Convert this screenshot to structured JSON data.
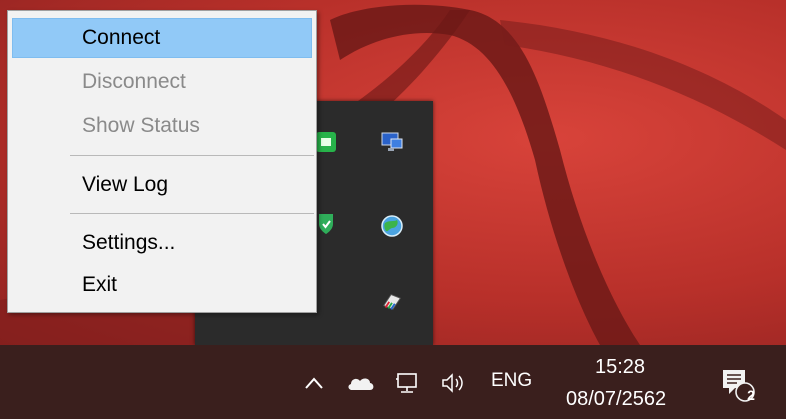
{
  "context_menu": {
    "items": [
      {
        "label": "Connect",
        "state": "highlighted"
      },
      {
        "label": "Disconnect",
        "state": "disabled"
      },
      {
        "label": "Show Status",
        "state": "disabled"
      },
      {
        "label": "View Log",
        "state": "normal"
      },
      {
        "label": "Settings...",
        "state": "normal"
      },
      {
        "label": "Exit",
        "state": "normal"
      }
    ]
  },
  "tray_flyout": {
    "icons": [
      "vpn-app-icon",
      "monitor-network-icon",
      "security-shield-icon",
      "globe-app-icon",
      "usb-device-icon"
    ]
  },
  "taskbar": {
    "language": "ENG",
    "time": "15:28",
    "date": "08/07/2562",
    "notification_count": "2",
    "icons": [
      "chevron-up-icon",
      "onedrive-cloud-icon",
      "network-icon",
      "volume-icon",
      "action-center-icon"
    ]
  },
  "colors": {
    "wallpaper": "#b8302a",
    "taskbar": "#3a1f1d",
    "menu_background": "#f2f2f2",
    "menu_highlight": "#91c9f7",
    "menu_disabled_text": "#8a8a8a"
  }
}
